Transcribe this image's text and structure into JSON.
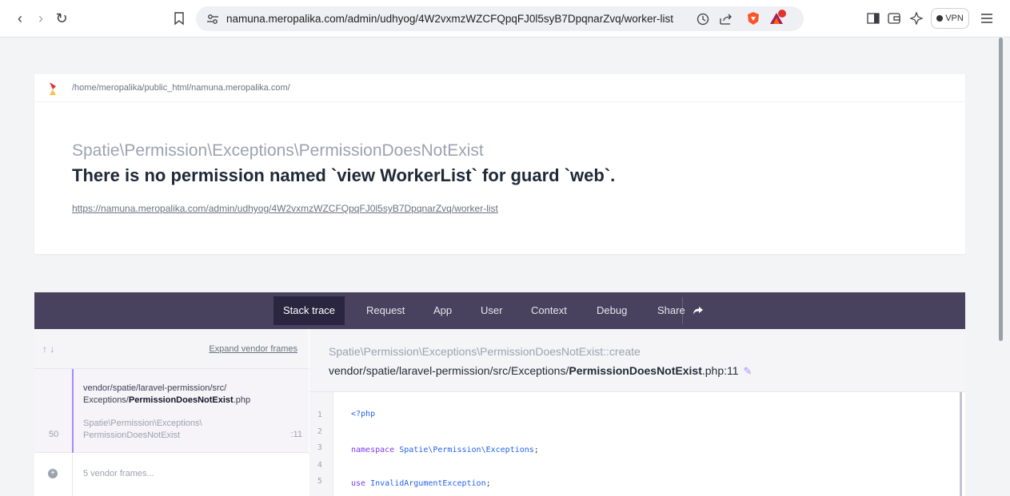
{
  "browser": {
    "url": "namuna.meropalika.com/admin/udhyog/4W2vxmzWZCFQpqFJ0l5syB7DpqnarZvq/worker-list",
    "vpn_label": "VPN"
  },
  "header": {
    "path": "/home/meropalika/public_html/namuna.meropalika.com/",
    "exception_class": "Spatie\\Permission\\Exceptions\\PermissionDoesNotExist",
    "message": "There is no permission named `view WorkerList` for guard `web`.",
    "url": "https://namuna.meropalika.com/admin/udhyog/4W2vxmzWZCFQpqFJ0l5syB7DpqnarZvq/worker-list"
  },
  "tabs": [
    {
      "label": "Stack trace"
    },
    {
      "label": "Request"
    },
    {
      "label": "App"
    },
    {
      "label": "User"
    },
    {
      "label": "Context"
    },
    {
      "label": "Debug"
    },
    {
      "label": "Share"
    }
  ],
  "frames": {
    "expand_label": "Expand vendor frames",
    "active": {
      "file_prefix": "vendor/spatie/laravel-permission/src/",
      "file_dir": "Exceptions/",
      "file_name": "PermissionDoesNotExist",
      "file_ext": ".php",
      "class_ns": "Spatie\\Permission\\Exceptions\\",
      "class_name": "PermissionDoesNotExist",
      "number": "50",
      "line": ":11"
    },
    "vendor": "5 vendor frames..."
  },
  "detail": {
    "method": "Spatie\\Permission\\Exceptions\\PermissionDoesNotExist::create",
    "loc_prefix": "vendor/spatie/laravel-permission/src/Exceptions/",
    "loc_file": "PermissionDoesNotExist",
    "loc_suffix": ".php:11"
  },
  "code": {
    "line_numbers": [
      "1",
      "2",
      "3",
      "4",
      "5"
    ],
    "line1": "<?php",
    "line3_kw": "namespace",
    "line3_ns": "Spatie\\Permission\\Exceptions",
    "line3_end": ";",
    "line5_kw": "use",
    "line5_cls": "InvalidArgumentException",
    "line5_end": ";"
  }
}
